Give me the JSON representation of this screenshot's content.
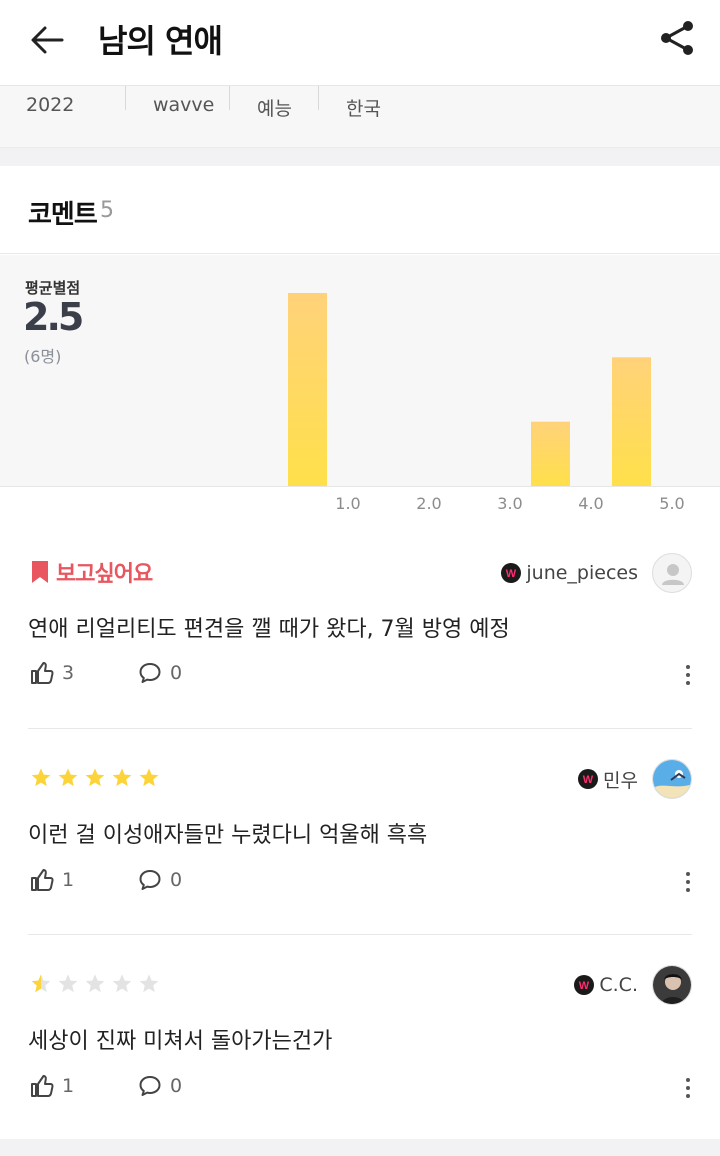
{
  "header": {
    "title": "남의 연애"
  },
  "meta": {
    "year": "2022",
    "platform": "wavve",
    "genre": "예능",
    "country": "한국"
  },
  "comments_section": {
    "title": "코멘트",
    "count": "5"
  },
  "rating": {
    "label": "평균별점",
    "average": "2.5",
    "count_text": "(6명)"
  },
  "chart_data": {
    "type": "bar",
    "title": "",
    "x": [
      0.5,
      1.0,
      1.5,
      2.0,
      2.5,
      3.0,
      3.5,
      4.0,
      4.5,
      5.0
    ],
    "values": [
      0,
      3,
      0,
      0,
      0,
      0,
      0,
      1,
      0,
      2
    ],
    "xticks": [
      "1.0",
      "2.0",
      "3.0",
      "4.0",
      "5.0"
    ],
    "xlabel": "",
    "ylabel": "",
    "colors": {
      "bar_top": "#ffd27a",
      "bar_bottom": "#ffe04a"
    }
  },
  "comments": [
    {
      "type": "want",
      "badge_label": "보고싶어요",
      "user": "june_pieces",
      "text": "연애 리얼리티도 편견을 깰 때가 왔다, 7월 방영 예정",
      "likes": "3",
      "replies": "0"
    },
    {
      "type": "rating",
      "stars": 5,
      "user": "민우",
      "text": "이런 걸 이성애자들만 누렸다니 억울해 흑흑",
      "likes": "1",
      "replies": "0"
    },
    {
      "type": "rating",
      "stars": 0.5,
      "user": "C.C.",
      "text": "세상이 진짜 미쳐서 돌아가는건가",
      "likes": "1",
      "replies": "0"
    }
  ],
  "colors": {
    "accent": "#e8565f",
    "star": "#fcd43a",
    "star_empty": "#e3e3e3"
  }
}
